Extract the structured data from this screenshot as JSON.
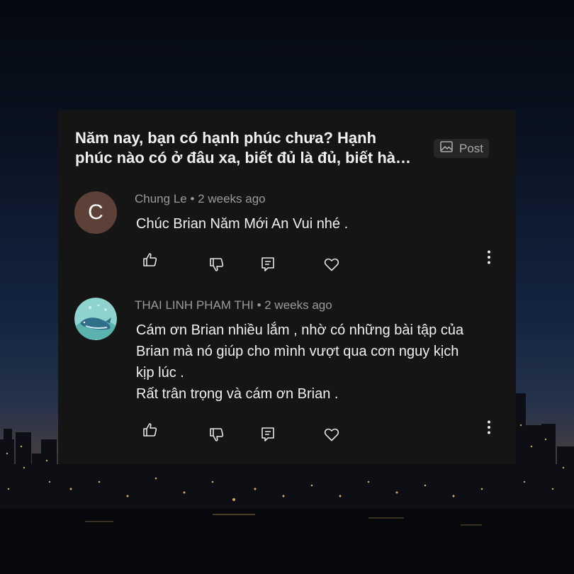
{
  "post": {
    "title": "Năm nay, bạn có hạnh phúc chưa? Hạnh phúc nào có ở đâu xa, biết đủ là đủ, biết hài lòng với những gì mình đang có",
    "badge_label": "Post"
  },
  "comments": [
    {
      "avatar_letter": "C",
      "author": "Chung Le",
      "time": "2 weeks ago",
      "text": [
        "Chúc Brian Năm Mới An Vui nhé ."
      ]
    },
    {
      "author": "THAI LINH PHAM THI",
      "time": "2 weeks ago",
      "text": [
        "Cám ơn Brian nhiều lắm , nhờ có những bài tập của",
        "Brian mà nó giúp cho mình vượt qua cơn nguy kịch",
        "kịp lúc .",
        "Rất trân trọng và cám ơn Brian ."
      ]
    }
  ],
  "icons": {
    "badge": "image-icon",
    "like": "thumbs-up-icon",
    "dislike": "thumbs-down-icon",
    "reply": "reply-comment-icon",
    "heart": "heart-icon",
    "more": "more-vert-icon"
  },
  "colors": {
    "card_bg": "#151515",
    "avatar_c": "#5d4037",
    "avatar_whale": "#8fd3cf"
  }
}
